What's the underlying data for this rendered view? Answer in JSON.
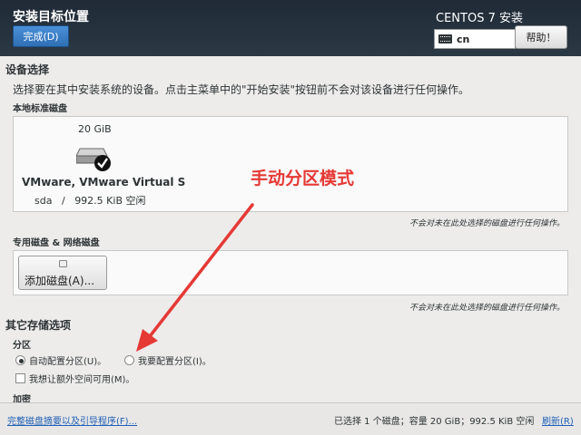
{
  "header": {
    "title": "安装目标位置",
    "done_label": "完成(D)",
    "product": "CENTOS 7 安装",
    "keyboard_layout": "cn",
    "help_label": "帮助！"
  },
  "device_selection": {
    "title": "设备选择",
    "description": "选择要在其中安装系统的设备。点击主菜单中的\"开始安装\"按钮前不会对该设备进行任何操作。",
    "local_disks_title": "本地标准磁盘",
    "disk": {
      "size": "20 GiB",
      "name": "VMware, VMware Virtual S",
      "device": "sda",
      "separator": "/",
      "free": "992.5 KiB 空闲"
    },
    "local_note": "不会对未在此处选择的磁盘进行任何操作。",
    "special_disks_title": "专用磁盘 & 网络磁盘",
    "add_disk_label": "添加磁盘(A)...",
    "special_note": "不会对未在此处选择的磁盘进行任何操作。"
  },
  "other_storage": {
    "title": "其它存储选项",
    "partitioning_title": "分区",
    "auto_label": "自动配置分区(U)。",
    "manual_label": "我要配置分区(I)。",
    "extra_space_label": "我想让额外空间可用(M)。",
    "encryption_title": "加密"
  },
  "annotation": {
    "text": "手动分区模式",
    "color": "#e53935"
  },
  "footer": {
    "summary_link": "完整磁盘摘要以及引导程序(F)...",
    "status": "已选择 1 个磁盘；容量 20 GiB；992.5 KiB 空闲",
    "refresh_label": "刷新(R)"
  }
}
